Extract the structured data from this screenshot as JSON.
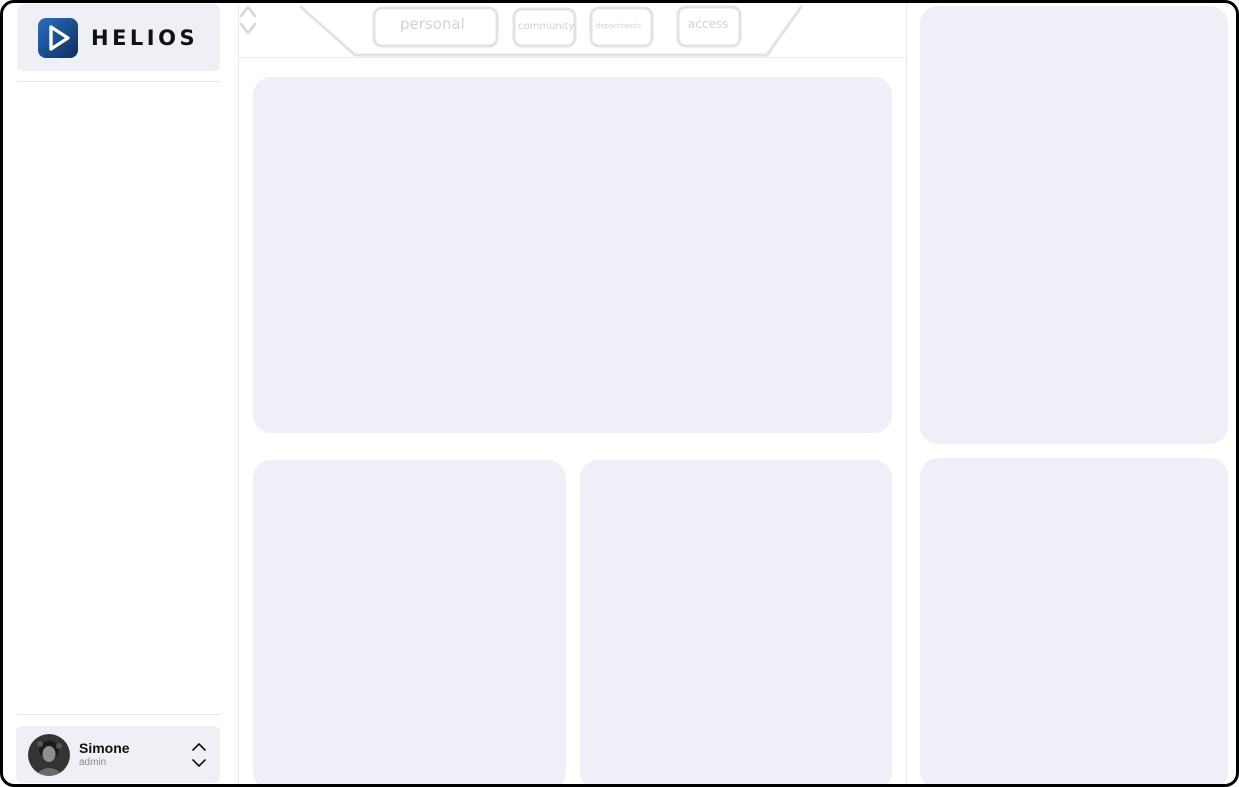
{
  "app": {
    "brand_name": "HELIOS",
    "logo_icon": "helios-play-logo-icon",
    "colors": {
      "accent": "#1f4e8c",
      "panel": "#efeff7",
      "sidebar_card": "#efeff6"
    }
  },
  "tabs": [
    {
      "label": "personal",
      "selected": true
    },
    {
      "label": "community"
    },
    {
      "label": "departments"
    },
    {
      "label": "access"
    }
  ],
  "user": {
    "name": "Simone",
    "role": "admin",
    "toggle_icon": "chevron-up-down-icon"
  },
  "panels": [
    {
      "id": "main-panel"
    },
    {
      "id": "bottom-left-panel"
    },
    {
      "id": "bottom-middle-panel"
    },
    {
      "id": "right-top-panel"
    },
    {
      "id": "right-bottom-panel"
    }
  ]
}
